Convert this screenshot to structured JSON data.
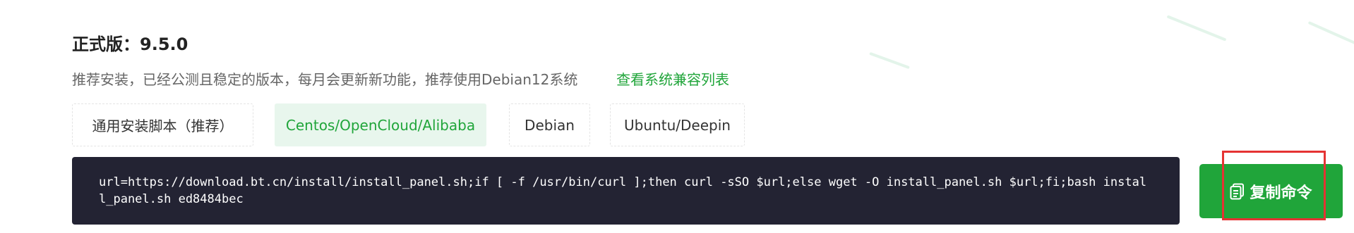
{
  "release": {
    "title": "正式版：9.5.0",
    "description": "推荐安装，已经公测且稳定的版本，每月会更新新功能，推荐使用Debian12系统",
    "compat_link": "查看系统兼容列表"
  },
  "tabs": [
    {
      "label": "通用安装脚本（推荐）",
      "active": false
    },
    {
      "label": "Centos/OpenCloud/Alibaba",
      "active": true
    },
    {
      "label": "Debian",
      "active": false
    },
    {
      "label": "Ubuntu/Deepin",
      "active": false
    }
  ],
  "command": {
    "text": "url=https://download.bt.cn/install/install_panel.sh;if [ -f /usr/bin/curl ];then curl -sSO $url;else wget -O install_panel.sh $url;fi;bash install_panel.sh ed8484bec"
  },
  "copy_button": {
    "label": "复制命令",
    "icon": "copy-icon"
  },
  "colors": {
    "accent": "#20a53a",
    "active_tab_bg": "#e8f6ed",
    "code_bg": "#232333",
    "highlight": "#e53333"
  }
}
